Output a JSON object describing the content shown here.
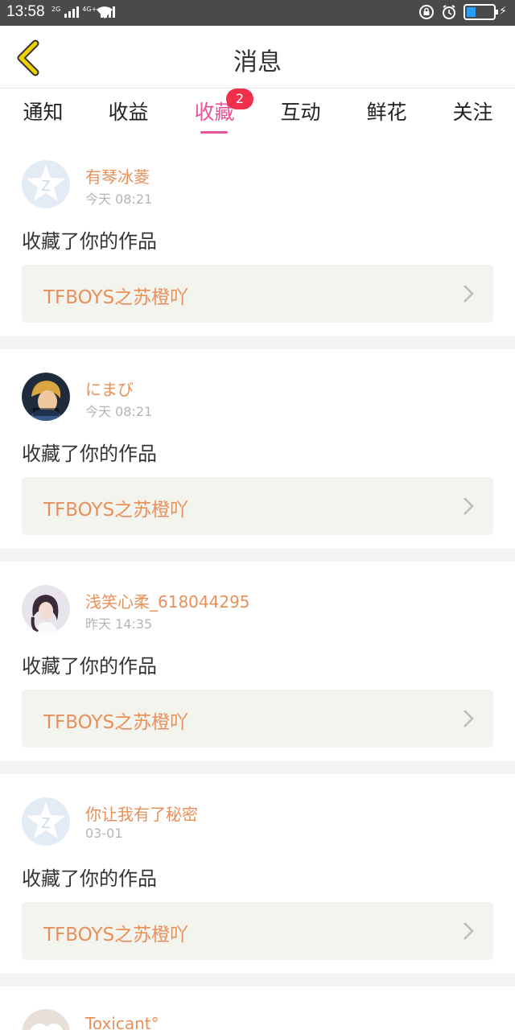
{
  "status": {
    "time": "13:58",
    "net1": "2G",
    "net2": "4G+"
  },
  "header": {
    "title": "消息"
  },
  "tabs": [
    {
      "label": "通知"
    },
    {
      "label": "收益"
    },
    {
      "label": "收藏",
      "badge": "2",
      "active": true
    },
    {
      "label": "互动"
    },
    {
      "label": "鲜花"
    },
    {
      "label": "关注"
    }
  ],
  "feed": [
    {
      "name": "有琴冰菱",
      "time": "今天 08:21",
      "action": "收藏了你的作品",
      "work": "TFBOYS之苏橙吖",
      "avatar": "qzone-default-avatar"
    },
    {
      "name": "にまび",
      "time": "今天 08:21",
      "action": "收藏了你的作品",
      "work": "TFBOYS之苏橙吖",
      "avatar": "cartoon-girl-avatar"
    },
    {
      "name": "浅笑心柔_618044295",
      "time": "昨天 14:35",
      "action": "收藏了你的作品",
      "work": "TFBOYS之苏橙吖",
      "avatar": "girl-photo-avatar"
    },
    {
      "name": "你让我有了秘密",
      "time": "03-01",
      "action": "收藏了你的作品",
      "work": "TFBOYS之苏橙吖",
      "avatar": "qzone-default-avatar"
    },
    {
      "name": "Toxicant°",
      "time": "",
      "action": "",
      "work": "",
      "avatar": "puppy-avatar"
    }
  ],
  "colors": {
    "accent": "#e8529a",
    "name": "#e8905a",
    "badge": "#f0304a",
    "back": "#f0d000"
  }
}
